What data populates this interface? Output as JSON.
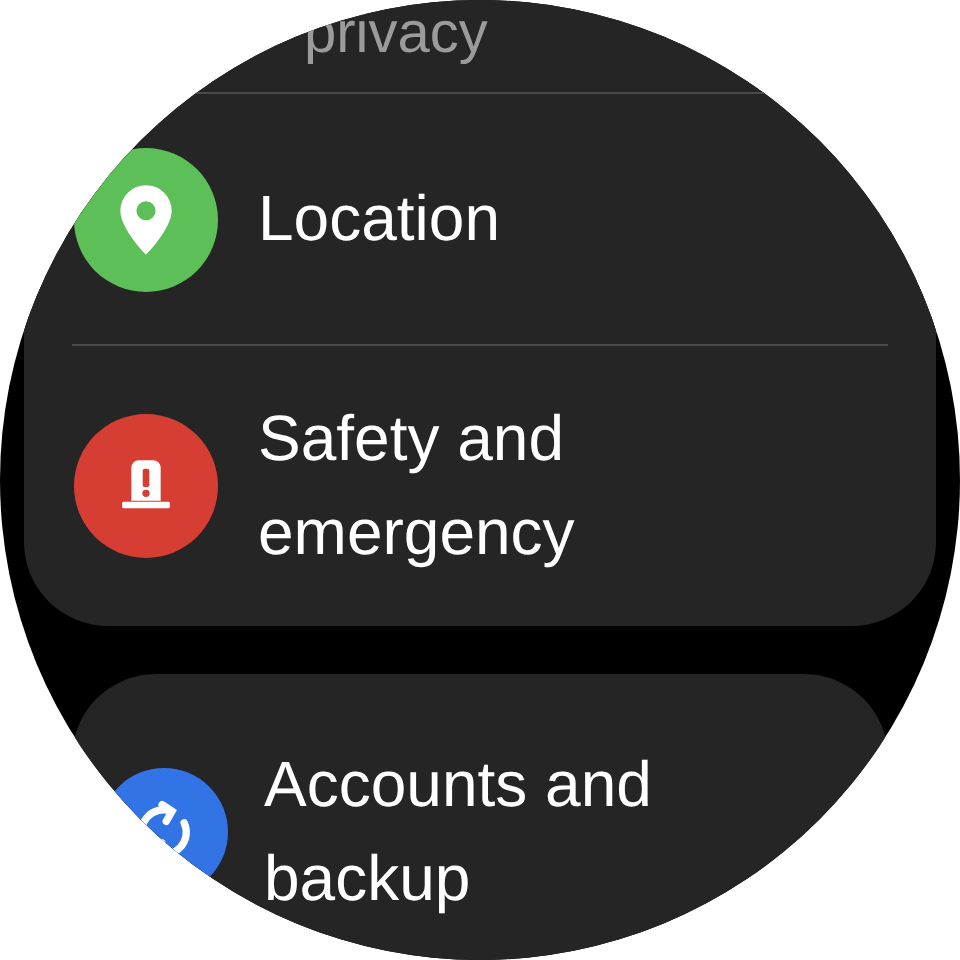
{
  "sections": [
    {
      "items": [
        {
          "label": "privacy",
          "dimmed": true
        },
        {
          "label": "Location",
          "kind": "pin",
          "color": "#5cbf57",
          "dimmed": false
        },
        {
          "label": "Safety and emergency",
          "kind": "siren",
          "color": "#d63e34",
          "dimmed": false
        }
      ]
    },
    {
      "items": [
        {
          "label": "Accounts and backup",
          "kind": "sync",
          "color": "#3274e6",
          "dimmed": false
        }
      ]
    }
  ]
}
